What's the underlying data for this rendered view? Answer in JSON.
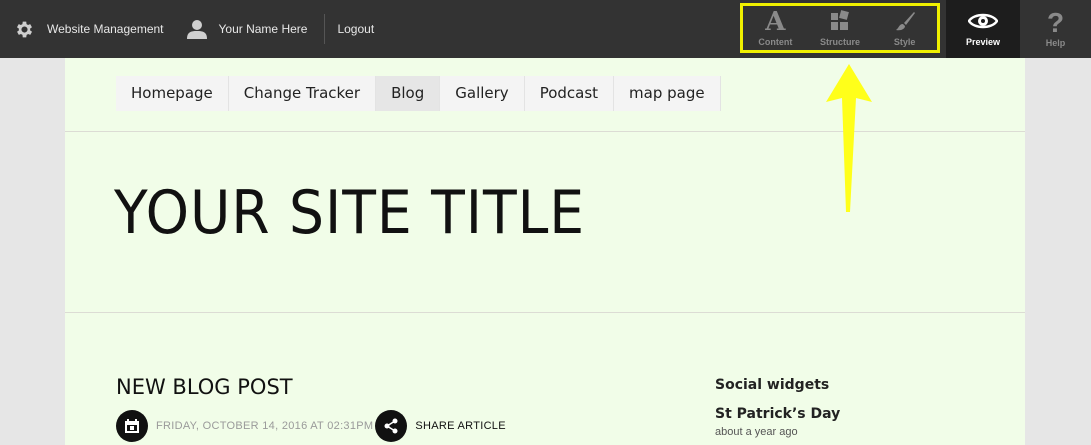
{
  "topbar": {
    "website_management": "Website Management",
    "user_name": "Your Name Here",
    "logout": "Logout",
    "tools": {
      "content": "Content",
      "structure": "Structure",
      "style": "Style"
    },
    "preview": "Preview",
    "help": "Help",
    "highlight_color": "#f0f000"
  },
  "nav": {
    "items": [
      "Homepage",
      "Change Tracker",
      "Blog",
      "Gallery",
      "Podcast",
      "map page"
    ],
    "active": "Blog"
  },
  "site": {
    "title": "YOUR SITE TITLE"
  },
  "post": {
    "title": "NEW BLOG POST",
    "date": "FRIDAY, OCTOBER 14, 2016 AT 02:31PM",
    "share": "SHARE ARTICLE"
  },
  "sidebar": {
    "heading": "Social widgets",
    "item_title": "St Patrick’s Day",
    "item_time": "about a year ago"
  },
  "annotation": {
    "arrow_color": "#ffff1a"
  }
}
